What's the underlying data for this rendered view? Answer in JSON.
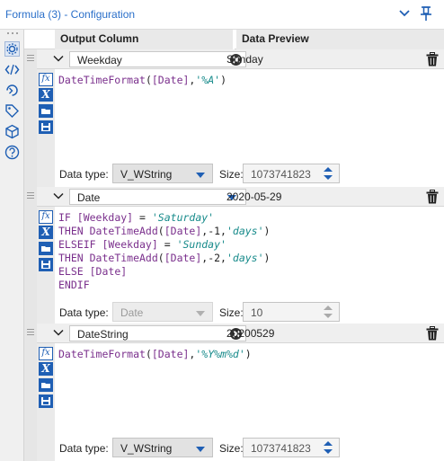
{
  "window": {
    "title": "Formula (3) - Configuration"
  },
  "columns": {
    "output": "Output Column",
    "preview": "Data Preview"
  },
  "records": [
    {
      "output_column": "Weekday",
      "preview": "Sunday",
      "expression": [
        [
          [
            "fn",
            "DateTimeFormat"
          ],
          [
            "p",
            "("
          ],
          [
            "fld",
            "[Date]"
          ],
          [
            "p",
            ","
          ],
          [
            "str",
            "'%A'"
          ],
          [
            "p",
            ")"
          ]
        ]
      ],
      "data_type_label": "Data type:",
      "data_type": "V_WString",
      "size_label": "Size:",
      "size": "1073741823",
      "type_disabled": false
    },
    {
      "output_column": "Date",
      "preview": "2020-05-29",
      "expression": [
        [
          [
            "kw",
            "IF "
          ],
          [
            "fld",
            "[Weekday]"
          ],
          [
            "p",
            " = "
          ],
          [
            "str",
            "'Saturday'"
          ]
        ],
        [
          [
            "kw",
            "THEN "
          ],
          [
            "fn",
            "DateTimeAdd"
          ],
          [
            "p",
            "("
          ],
          [
            "fld",
            "[Date]"
          ],
          [
            "p",
            ",-1,"
          ],
          [
            "str",
            "'days'"
          ],
          [
            "p",
            ")"
          ]
        ],
        [
          [
            "kw",
            "ELSEIF "
          ],
          [
            "fld",
            "[Weekday]"
          ],
          [
            "p",
            " = "
          ],
          [
            "str",
            "'Sunday'"
          ]
        ],
        [
          [
            "kw",
            "THEN "
          ],
          [
            "fn",
            "DateTimeAdd"
          ],
          [
            "p",
            "("
          ],
          [
            "fld",
            "[Date]"
          ],
          [
            "p",
            ",-2,"
          ],
          [
            "str",
            "'days'"
          ],
          [
            "p",
            ")"
          ]
        ],
        [
          [
            "kw",
            "ELSE "
          ],
          [
            "fld",
            "[Date]"
          ]
        ],
        [
          [
            "kw",
            "ENDIF"
          ]
        ]
      ],
      "data_type_label": "Data type:",
      "data_type": "Date",
      "size_label": "Size:",
      "size": "10",
      "type_disabled": true
    },
    {
      "output_column": "DateString",
      "preview": "20200529",
      "expression": [
        [
          [
            "fn",
            "DateTimeFormat"
          ],
          [
            "p",
            "("
          ],
          [
            "fld",
            "[Date]"
          ],
          [
            "p",
            ","
          ],
          [
            "str",
            "'%Y%m%d'"
          ],
          [
            "p",
            ")"
          ]
        ]
      ],
      "data_type_label": "Data type:",
      "data_type": "V_WString",
      "size_label": "Size:",
      "size": "1073741823",
      "type_disabled": false
    }
  ],
  "tools": {
    "fx": "fx",
    "x": "X"
  },
  "colors": {
    "accent": "#1f5fb4",
    "title": "#2a6fc9",
    "keyword": "#7a2f8c",
    "string": "#168a8a"
  },
  "icons": {
    "sidebar": [
      "gear-icon",
      "code-icon",
      "workflow-icon",
      "tag-icon",
      "cube-icon",
      "help-icon"
    ],
    "titlebar": [
      "chevron-down-icon",
      "pin-icon"
    ]
  }
}
